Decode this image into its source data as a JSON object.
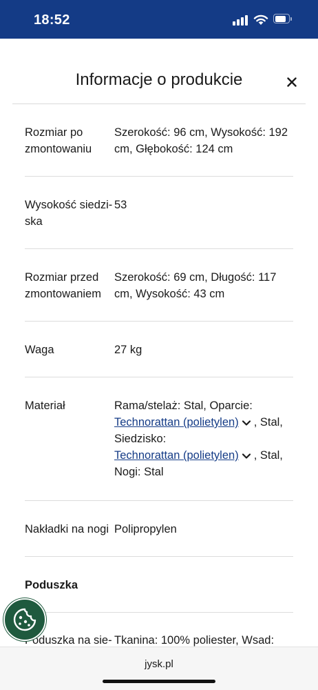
{
  "status_bar": {
    "time": "18:52"
  },
  "panel": {
    "title": "Informacje o produkcie",
    "close_symbol": "close-icon"
  },
  "rows": [
    {
      "label": "Rozmiar po zmontowaniu",
      "value": "Szerokość: 96 cm, Wysokość: 192 cm, Głębokość: 124 cm"
    },
    {
      "label": "Wysokość siedzi-ska",
      "value": "53"
    },
    {
      "label": "Rozmiar przed zmontowaniem",
      "value": "Szerokość: 69 cm, Długość: 117 cm, Wysokość: 43 cm"
    },
    {
      "label": "Waga",
      "value": "27 kg"
    },
    {
      "label": "Materiał",
      "value_prefix": "Rama/stelaż: Stal, Oparcie:",
      "link1": "Technorattan (polietylen)",
      "after_link1": ", Stal,",
      "mid": "Siedzisko:",
      "link2": "Technorattan (polietylen)",
      "after_link2": ", Stal,",
      "suffix": "Nogi: Stal"
    },
    {
      "label": "Nakładki na nogi",
      "value": "Polipropylen"
    },
    {
      "label": "Poduszka",
      "value": ""
    },
    {
      "label": "Poduszka na sie-",
      "value": "Tkanina: 100% poliester, Wsad:"
    }
  ],
  "browser": {
    "url": "jysk.pl"
  },
  "colors": {
    "brand": "#143b86",
    "cookie_button": "#1f5a3e"
  }
}
